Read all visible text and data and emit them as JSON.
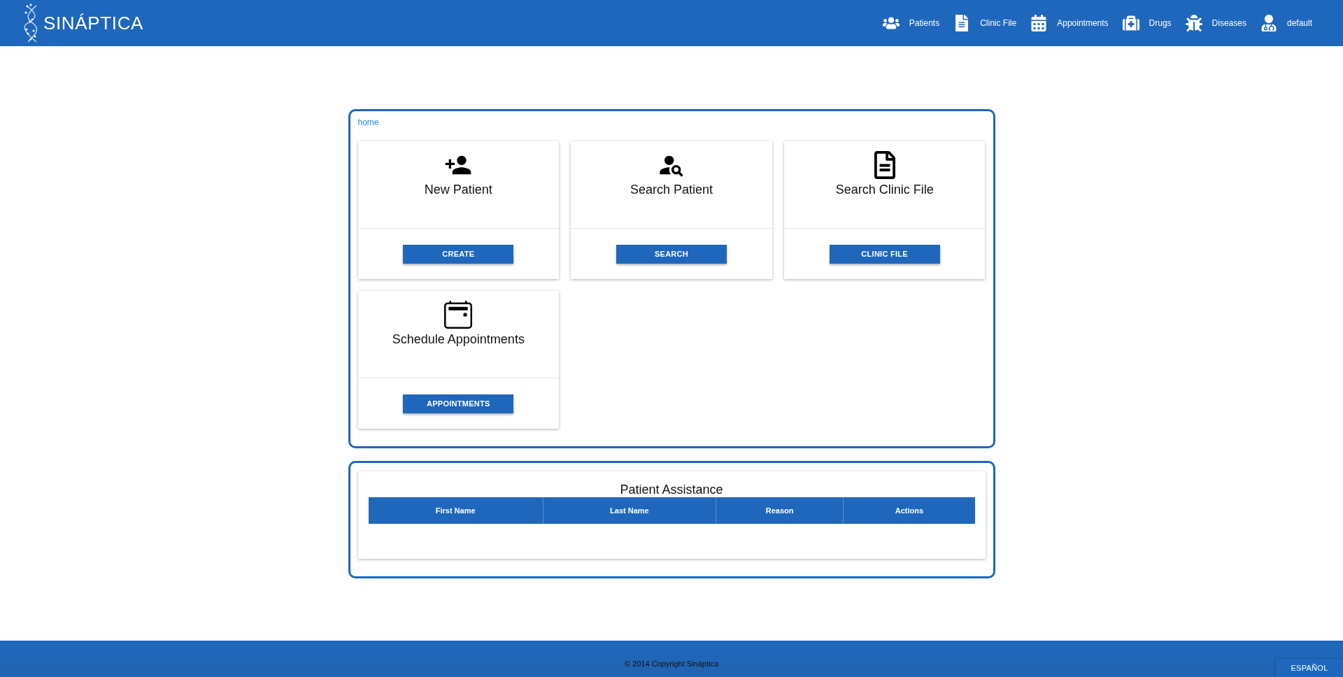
{
  "header": {
    "logo": "SINÁPTICA",
    "nav": [
      {
        "label": "Patients"
      },
      {
        "label": "Clinic File"
      },
      {
        "label": "Appointments"
      },
      {
        "label": "Drugs"
      },
      {
        "label": "Diseases"
      },
      {
        "label": "default"
      }
    ]
  },
  "breadcrumb": "home",
  "cards": [
    {
      "title": "New Patient",
      "button": "CREATE"
    },
    {
      "title": "Search Patient",
      "button": "SEARCH"
    },
    {
      "title": "Search Clinic File",
      "button": "CLINIC FILE"
    },
    {
      "title": "Schedule Appointments",
      "button": "APPOINTMENTS"
    }
  ],
  "assistance": {
    "title": "Patient Assistance",
    "columns": [
      "First Name",
      "Last Name",
      "Reason",
      "Actions"
    ]
  },
  "footer": {
    "copyright": "© 2014 Copyright Sináptica",
    "language": "ESPAÑOL"
  }
}
